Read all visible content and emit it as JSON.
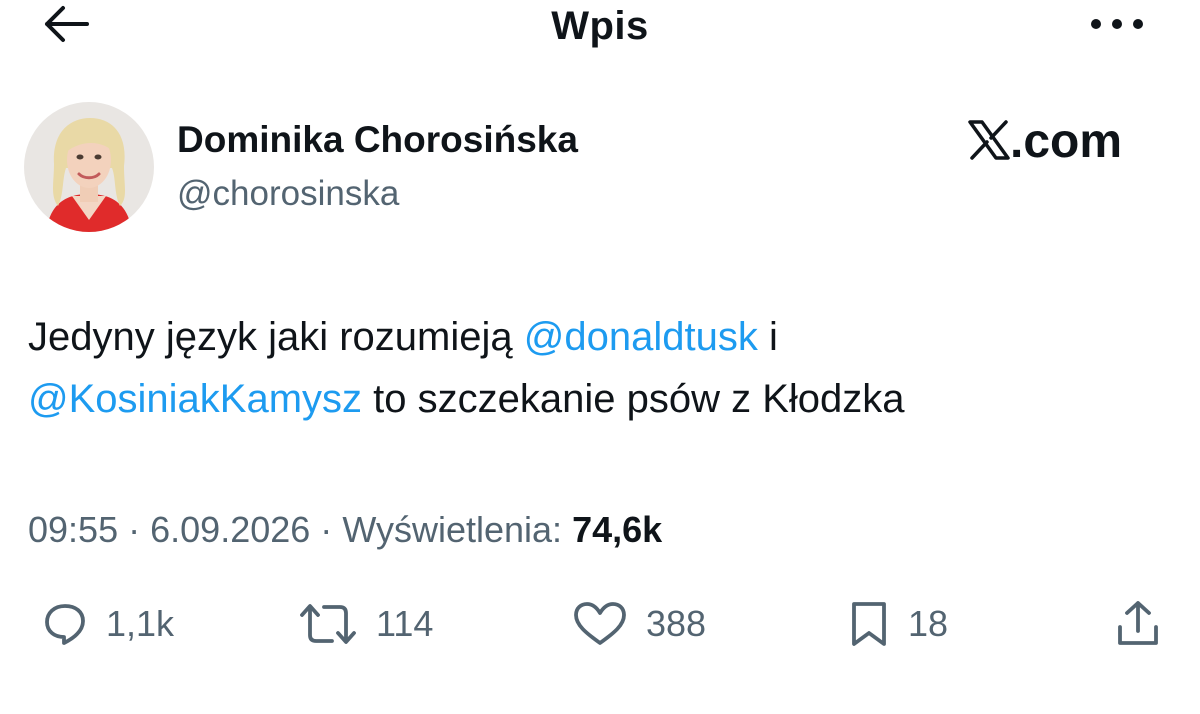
{
  "header": {
    "title": "Wpis",
    "back_icon": "arrow-left-icon",
    "more_icon": "more-horizontal-icon"
  },
  "author": {
    "name": "Dominika Chorosińska",
    "handle": "@chorosinska"
  },
  "watermark": {
    "text": ".com",
    "logo": "x-logo-icon"
  },
  "tweet": {
    "text_part1": "Jedyny język jaki rozumieją ",
    "mention1": "@donaldtusk",
    "text_part2": " i ",
    "mention2": "@KosiniakKamysz",
    "text_part3": " to szczekanie psów z Kłodzka"
  },
  "meta": {
    "time": "09:55",
    "date": "6.09.2026",
    "views_label": "Wyświetlenia:",
    "views_count": "74,6k",
    "separator": "·"
  },
  "actions": {
    "replies": "1,1k",
    "reposts": "114",
    "likes": "388",
    "bookmarks": "18"
  },
  "colors": {
    "text": "#0f1419",
    "secondary": "#536471",
    "link": "#1d9bf0"
  }
}
